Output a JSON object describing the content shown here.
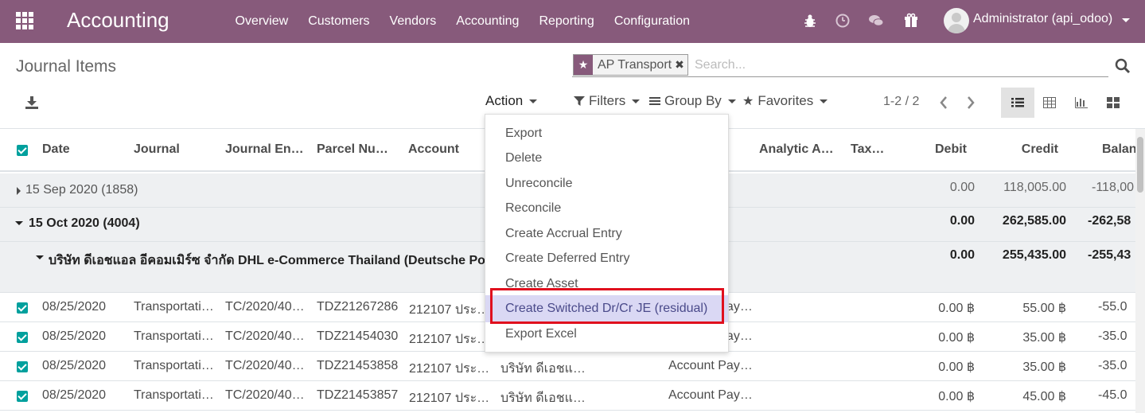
{
  "navbar": {
    "brand": "Accounting",
    "menu": [
      "Overview",
      "Customers",
      "Vendors",
      "Accounting",
      "Reporting",
      "Configuration"
    ],
    "user": "Administrator (api_odoo)",
    "icons": [
      "bug-icon",
      "clock-icon",
      "chat-icon",
      "gift-icon"
    ]
  },
  "control": {
    "breadcrumb": "Journal Items",
    "facet": "AP Transport",
    "search_placeholder": "Search...",
    "action_label": "Action",
    "filters_label": "Filters",
    "groupby_label": "Group By",
    "favorites_label": "Favorites",
    "pager": "1-2 / 2"
  },
  "table": {
    "headers": {
      "date": "Date",
      "journal": "Journal",
      "journal_entry": "Journal En…",
      "parcel": "Parcel Nu…",
      "account": "Account",
      "analytic": "Analytic A…",
      "tax": "Tax…",
      "debit": "Debit",
      "credit": "Credit",
      "balance": "Balan"
    },
    "groups": [
      {
        "label": "15 Sep 2020 (1858)",
        "debit": "0.00",
        "credit": "118,005.00",
        "balance": "-118,00"
      },
      {
        "label": "15 Oct 2020 (4004)",
        "debit": "0.00",
        "credit": "262,585.00",
        "balance": "-262,58"
      },
      {
        "label": "บริษัท ดีเอชแอล อีคอมเมิร์ซ จำกัด DHL e-Commerce Thailand (Deutsche Post",
        "debit": "0.00",
        "credit": "255,435.00",
        "balance": "-255,43"
      }
    ],
    "rows": [
      {
        "date": "08/25/2020",
        "journal": "Transportati…",
        "entry": "TC/2020/40…",
        "parcel": "TDZ21267286",
        "account": "212107 ประ…",
        "partner": "",
        "label": "Account Pay…",
        "debit": "0.00 ฿",
        "credit": "55.00 ฿",
        "balance": "-55.0"
      },
      {
        "date": "08/25/2020",
        "journal": "Transportati…",
        "entry": "TC/2020/40…",
        "parcel": "TDZ21454030",
        "account": "212107 ประ…",
        "partner": "",
        "label": "Account Pay…",
        "debit": "0.00 ฿",
        "credit": "35.00 ฿",
        "balance": "-35.0"
      },
      {
        "date": "08/25/2020",
        "journal": "Transportati…",
        "entry": "TC/2020/40…",
        "parcel": "TDZ21453858",
        "account": "212107 ประ…",
        "partner": "บริษัท ดีเอชแ…",
        "label": "Account Pay…",
        "debit": "0.00 ฿",
        "credit": "35.00 ฿",
        "balance": "-35.0"
      },
      {
        "date": "08/25/2020",
        "journal": "Transportati…",
        "entry": "TC/2020/40…",
        "parcel": "TDZ21453857",
        "account": "212107 ประ…",
        "partner": "บริษัท ดีเอชแ…",
        "label": "Account Pay…",
        "debit": "0.00 ฿",
        "credit": "45.00 ฿",
        "balance": "-45.0"
      }
    ]
  },
  "action_menu": {
    "items": [
      "Export",
      "Delete",
      "Unreconcile",
      "Reconcile",
      "Create Accrual Entry",
      "Create Deferred Entry",
      "Create Asset",
      "Create Switched Dr/Cr JE (residual)",
      "Export Excel"
    ],
    "highlighted_index": 7
  },
  "colors": {
    "brand": "#875a7b",
    "checkbox": "#00a09d",
    "highlight_box": "#e0101e",
    "highlight_item": "#dad8f4"
  }
}
